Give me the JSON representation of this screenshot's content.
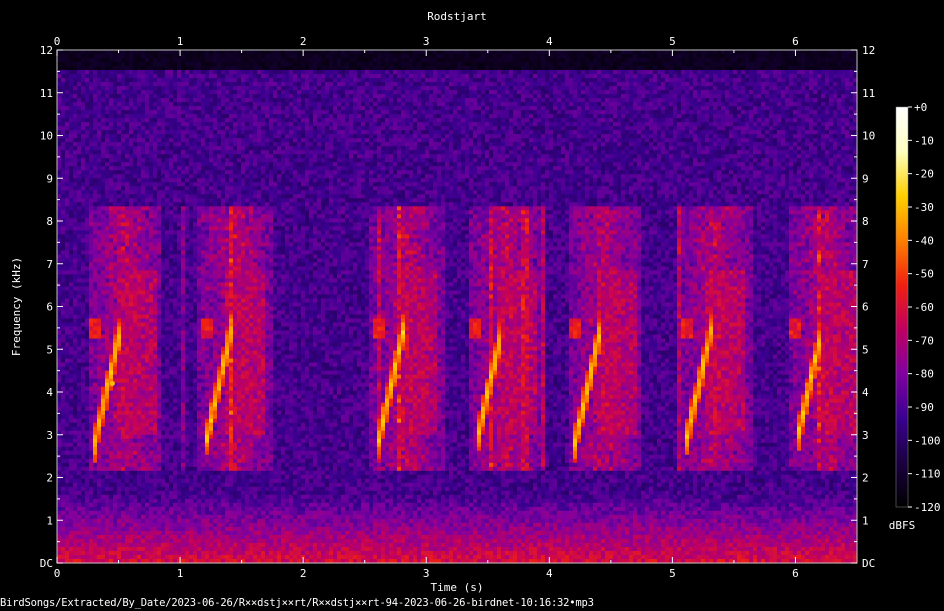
{
  "chart_data": {
    "type": "heatmap",
    "title": "Rodstjart",
    "xlabel": "Time (s)",
    "ylabel": "Frequency (kHz)",
    "xlim": [
      0,
      6.5
    ],
    "ylim": [
      0,
      12
    ],
    "x_ticks": [
      "0",
      "1",
      "2",
      "3",
      "4",
      "5",
      "6"
    ],
    "y_ticks": [
      "DC",
      "1",
      "2",
      "3",
      "4",
      "5",
      "6",
      "7",
      "8",
      "9",
      "10",
      "11",
      "12"
    ],
    "colorbar": {
      "label": "dBFS",
      "ticks": [
        "+0",
        "-10",
        "-20",
        "-30",
        "-40",
        "-50",
        "-60",
        "-70",
        "-80",
        "-90",
        "-100",
        "-110",
        "-120"
      ],
      "range": [
        -120,
        0
      ],
      "colormap": [
        "#000000",
        "#1a0040",
        "#3a0090",
        "#8000a0",
        "#c00060",
        "#f02010",
        "#ff8000",
        "#ffd000",
        "#ffffc0",
        "#ffffff"
      ]
    },
    "phrases_time_s": [
      0.3,
      1.2,
      2.6,
      3.4,
      4.2,
      5.1,
      6.0
    ],
    "phrase_freq_khz": [
      2.7,
      5.5
    ],
    "peak": {
      "time_s": 0.45,
      "freq_khz": 4.2,
      "level_dbfs": -30
    }
  },
  "footer": {
    "filepath": "BirdSongs/Extracted/By_Date/2023-06-26/R××dstj××rt/R××dstj××rt-94-2023-06-26-birdnet-10:16:32•mp3"
  }
}
